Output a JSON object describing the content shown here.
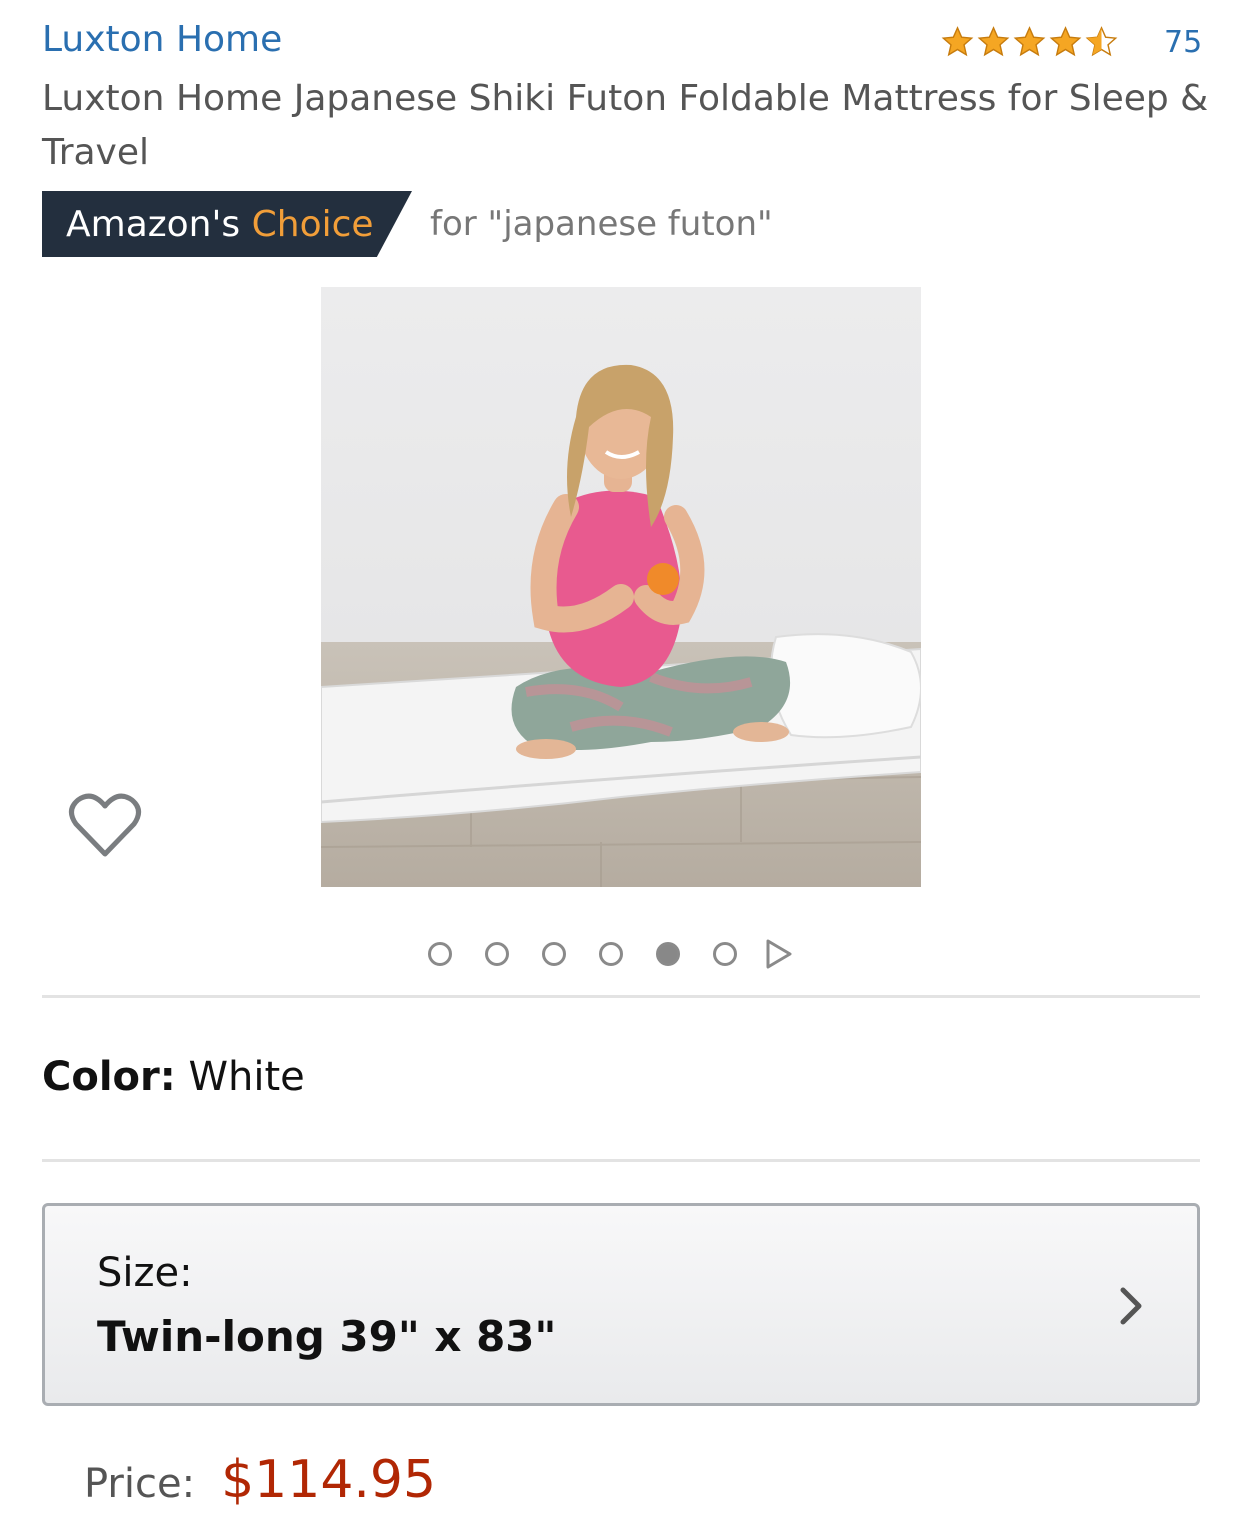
{
  "product": {
    "brand": "Luxton Home",
    "title": "Luxton Home Japanese Shiki Futon Foldable Mattress for Sleep & Travel",
    "rating": 4.5,
    "rating_max": 5,
    "review_count": "75"
  },
  "badge": {
    "prefix": "Amazon's",
    "highlight": "Choice",
    "context": "for \"japanese futon\""
  },
  "gallery": {
    "image_count": 6,
    "active_index": 4
  },
  "color": {
    "label": "Color:",
    "value": "White"
  },
  "size": {
    "label": "Size:",
    "value": "Twin-long 39\" x 83\""
  },
  "price": {
    "label": "Price:",
    "value": "$114.95"
  },
  "theme": {
    "link_color": "#2a6fb0",
    "star_color": "#f5a623",
    "badge_bg": "#232f3e",
    "badge_highlight": "#f19e39",
    "price_color": "#b12704"
  },
  "icons": {
    "wishlist": "heart-outline-icon",
    "next": "play-triangle-icon",
    "size_selector": "chevron-right-icon"
  }
}
